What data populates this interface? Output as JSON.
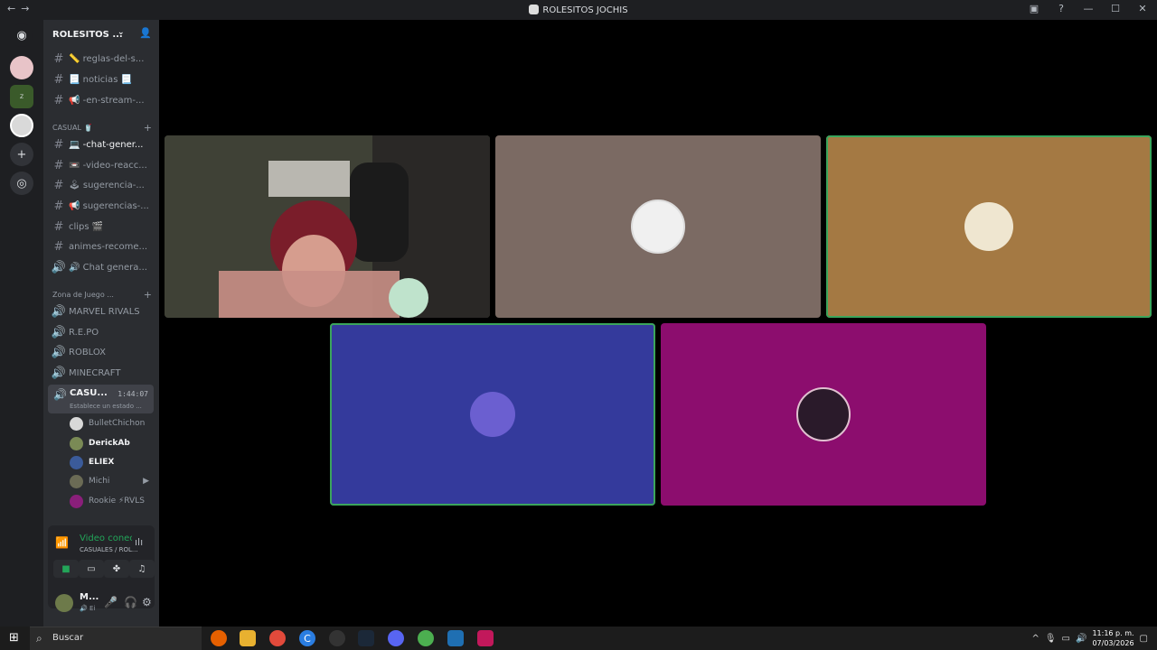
{
  "window": {
    "title": "ROLESITOS JOCHIS",
    "nav_back": "←",
    "nav_forward": "→"
  },
  "server": {
    "name": "ROLESITOS ...",
    "channels_top": [
      {
        "name": "📏 reglas-del-s...",
        "symbol": "#"
      },
      {
        "name": "📃 noticias 📃",
        "symbol": "#"
      },
      {
        "name": "📢 -en-stream-...",
        "symbol": "#"
      }
    ],
    "category_casual": "CASUAL 🥤",
    "channels_casual": [
      {
        "name": "💻 -chat-gener...",
        "symbol": "#"
      },
      {
        "name": "📼 -video-reacc...",
        "symbol": "#"
      },
      {
        "name": "🕹 sugerencia-...",
        "symbol": "#"
      },
      {
        "name": "📢 sugerencias-...",
        "symbol": "#"
      },
      {
        "name": "clips 🎬",
        "symbol": "#"
      },
      {
        "name": "animes-recome...",
        "symbol": "#"
      },
      {
        "name": "🔊 Chat genera...",
        "symbol": "🔊"
      }
    ],
    "category_games": "Zona de Juego ...",
    "voice_channels": [
      {
        "name": "MARVEL RIVALS"
      },
      {
        "name": "R.E.PO"
      },
      {
        "name": "ROBLOX"
      },
      {
        "name": "MINECRAFT"
      }
    ],
    "active_voice": {
      "name": "CASU...",
      "timer": "1:44:07",
      "status": "Establece un estado ..."
    },
    "voice_users": [
      {
        "name": "BulletChichon",
        "bold": false,
        "color": "#d8d8d8"
      },
      {
        "name": "DerickAb",
        "bold": true,
        "color": "#7a8a55"
      },
      {
        "name": "ELIEX",
        "bold": true,
        "color": "#3b5b9a"
      },
      {
        "name": "Michi",
        "bold": false,
        "color": "#6b6b55"
      },
      {
        "name": "Rookie ⚡RVLS",
        "bold": false,
        "color": "#8a1f7a"
      }
    ]
  },
  "connection": {
    "status": "Video conectado",
    "channel": "CASUALES / ROL...",
    "buttons": [
      "camera-icon",
      "screen-share-icon",
      "activities-icon",
      "soundboard-icon"
    ]
  },
  "user": {
    "name": "M...",
    "status": "🔊 Ei"
  },
  "tiles": [
    {
      "name": "camera",
      "bg": "#3d3f33",
      "speaking": false
    },
    {
      "name": "user-a",
      "bg": "#7b6a63",
      "speaking": false
    },
    {
      "name": "user-b",
      "bg": "#a47943",
      "speaking": true
    },
    {
      "name": "user-c",
      "bg": "#343a9c",
      "speaking": true
    },
    {
      "name": "user-d",
      "bg": "#8c0d6e",
      "speaking": false
    }
  ],
  "taskbar": {
    "search_placeholder": "Buscar",
    "time": "11:16 p. m.",
    "date": "07/03/2026"
  },
  "colors": {
    "accent_green": "#23a559",
    "sidebar": "#2b2d31",
    "guilds": "#1e1f22"
  }
}
